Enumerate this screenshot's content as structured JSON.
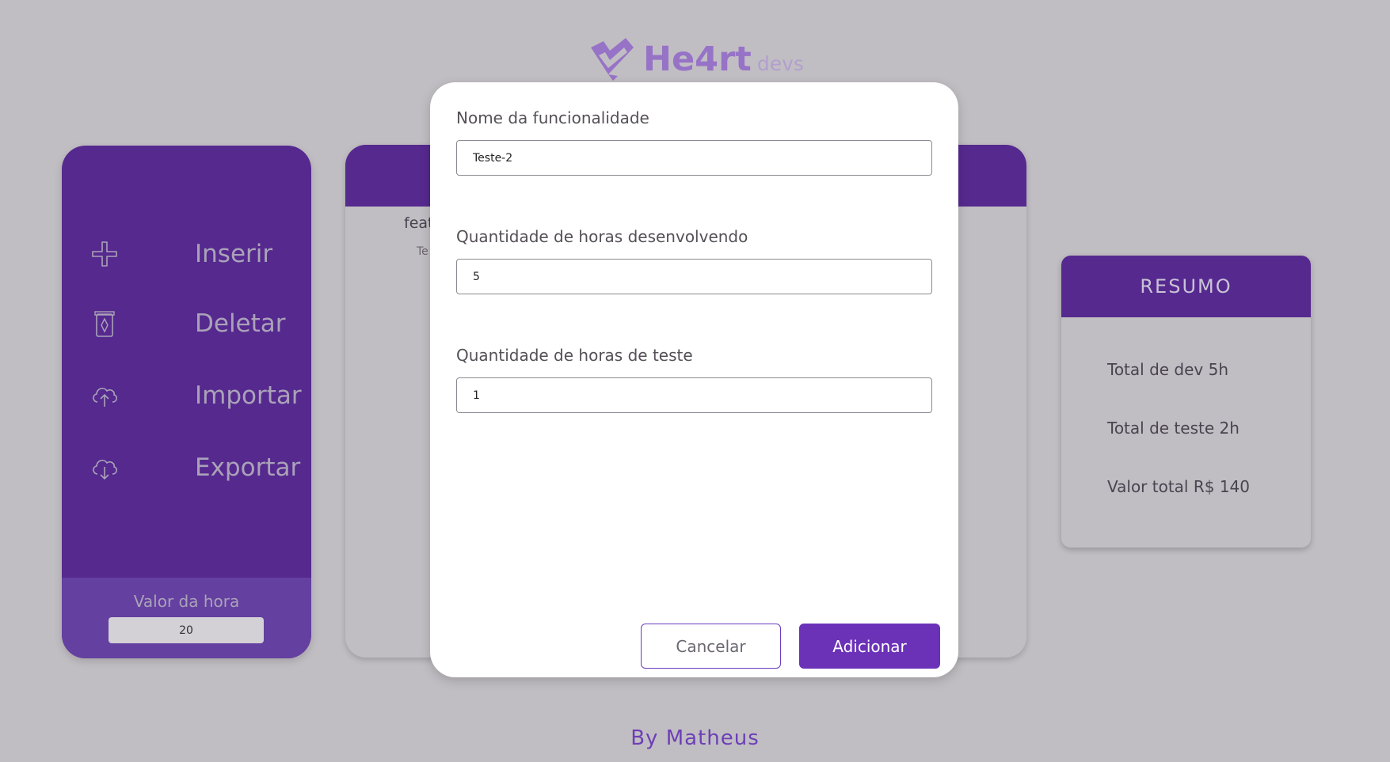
{
  "brand": {
    "name": "He4rt",
    "suffix": "devs",
    "icon": "heart-check-logo-icon"
  },
  "sidebar": {
    "items": [
      {
        "label": "Inserir",
        "icon": "plus-icon"
      },
      {
        "label": "Deletar",
        "icon": "trash-icon"
      },
      {
        "label": "Importar",
        "icon": "cloud-upload-icon"
      },
      {
        "label": "Exportar",
        "icon": "cloud-download-icon"
      }
    ],
    "rate": {
      "label": "Valor da hora",
      "value": "20"
    }
  },
  "list": {
    "column_partial": "feat",
    "cell_partial": "Te"
  },
  "modal": {
    "name_label": "Nome da funcionalidade",
    "name_value": "Teste-2",
    "dev_label": "Quantidade de horas desenvolvendo",
    "dev_value": "5",
    "test_label": "Quantidade de horas de teste",
    "test_value": "1",
    "cancel_label": "Cancelar",
    "add_label": "Adicionar"
  },
  "summary": {
    "title": "RESUMO",
    "total_dev": "Total de dev 5h",
    "total_test": "Total de teste 2h",
    "total_value": "Valor total R$ 140"
  },
  "footer": {
    "text": "By Matheus"
  },
  "colors": {
    "background": "#c1bec3",
    "primary": "#56298f",
    "accent": "#6b32b8",
    "logo": "#8a5ac9"
  }
}
